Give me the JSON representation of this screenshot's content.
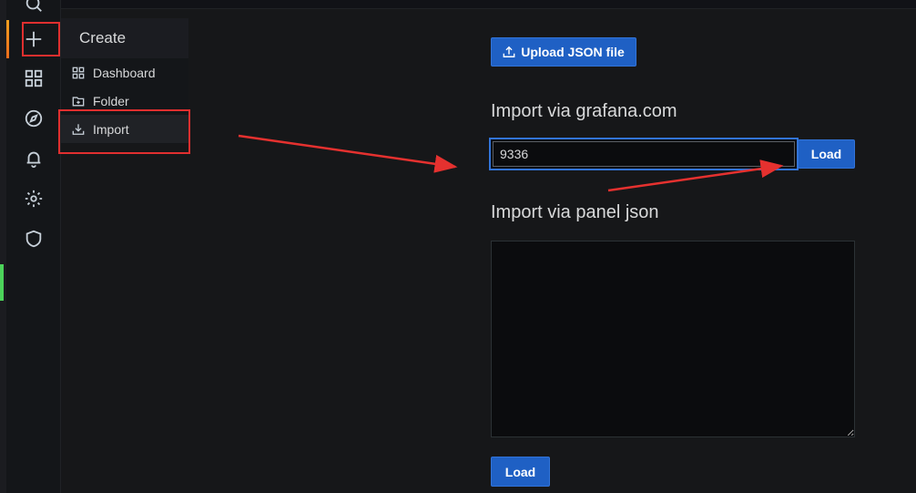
{
  "sidebar": {
    "icons": [
      "search-icon",
      "plus-icon",
      "dashboards-icon",
      "explore-icon",
      "alerting-icon",
      "settings-icon",
      "shield-icon"
    ]
  },
  "create_menu": {
    "title": "Create",
    "items": [
      {
        "label": "Dashboard",
        "icon": "apps-icon"
      },
      {
        "label": "Folder",
        "icon": "folder-plus-icon"
      },
      {
        "label": "Import",
        "icon": "import-icon",
        "active": true
      }
    ]
  },
  "import_page": {
    "upload_label": "Upload JSON file",
    "grafana_com": {
      "title": "Import via grafana.com",
      "input_value": "9336",
      "load_label": "Load"
    },
    "panel_json": {
      "title": "Import via panel json",
      "textarea_value": "",
      "load_label": "Load"
    }
  },
  "colors": {
    "primary_button": "#1f60c4",
    "annotation_red": "#e02f2f",
    "background": "#161719"
  }
}
